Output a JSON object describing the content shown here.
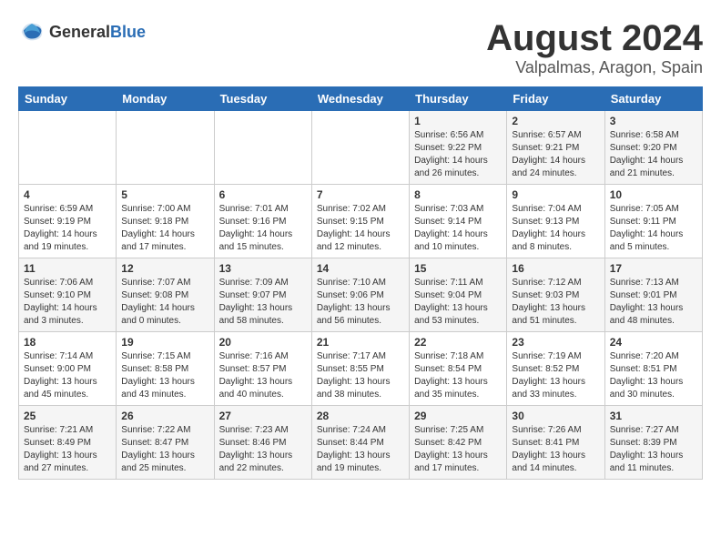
{
  "header": {
    "logo_general": "General",
    "logo_blue": "Blue",
    "month_title": "August 2024",
    "location": "Valpalmas, Aragon, Spain"
  },
  "weekdays": [
    "Sunday",
    "Monday",
    "Tuesday",
    "Wednesday",
    "Thursday",
    "Friday",
    "Saturday"
  ],
  "weeks": [
    [
      {
        "day": "",
        "content": ""
      },
      {
        "day": "",
        "content": ""
      },
      {
        "day": "",
        "content": ""
      },
      {
        "day": "",
        "content": ""
      },
      {
        "day": "1",
        "content": "Sunrise: 6:56 AM\nSunset: 9:22 PM\nDaylight: 14 hours\nand 26 minutes."
      },
      {
        "day": "2",
        "content": "Sunrise: 6:57 AM\nSunset: 9:21 PM\nDaylight: 14 hours\nand 24 minutes."
      },
      {
        "day": "3",
        "content": "Sunrise: 6:58 AM\nSunset: 9:20 PM\nDaylight: 14 hours\nand 21 minutes."
      }
    ],
    [
      {
        "day": "4",
        "content": "Sunrise: 6:59 AM\nSunset: 9:19 PM\nDaylight: 14 hours\nand 19 minutes."
      },
      {
        "day": "5",
        "content": "Sunrise: 7:00 AM\nSunset: 9:18 PM\nDaylight: 14 hours\nand 17 minutes."
      },
      {
        "day": "6",
        "content": "Sunrise: 7:01 AM\nSunset: 9:16 PM\nDaylight: 14 hours\nand 15 minutes."
      },
      {
        "day": "7",
        "content": "Sunrise: 7:02 AM\nSunset: 9:15 PM\nDaylight: 14 hours\nand 12 minutes."
      },
      {
        "day": "8",
        "content": "Sunrise: 7:03 AM\nSunset: 9:14 PM\nDaylight: 14 hours\nand 10 minutes."
      },
      {
        "day": "9",
        "content": "Sunrise: 7:04 AM\nSunset: 9:13 PM\nDaylight: 14 hours\nand 8 minutes."
      },
      {
        "day": "10",
        "content": "Sunrise: 7:05 AM\nSunset: 9:11 PM\nDaylight: 14 hours\nand 5 minutes."
      }
    ],
    [
      {
        "day": "11",
        "content": "Sunrise: 7:06 AM\nSunset: 9:10 PM\nDaylight: 14 hours\nand 3 minutes."
      },
      {
        "day": "12",
        "content": "Sunrise: 7:07 AM\nSunset: 9:08 PM\nDaylight: 14 hours\nand 0 minutes."
      },
      {
        "day": "13",
        "content": "Sunrise: 7:09 AM\nSunset: 9:07 PM\nDaylight: 13 hours\nand 58 minutes."
      },
      {
        "day": "14",
        "content": "Sunrise: 7:10 AM\nSunset: 9:06 PM\nDaylight: 13 hours\nand 56 minutes."
      },
      {
        "day": "15",
        "content": "Sunrise: 7:11 AM\nSunset: 9:04 PM\nDaylight: 13 hours\nand 53 minutes."
      },
      {
        "day": "16",
        "content": "Sunrise: 7:12 AM\nSunset: 9:03 PM\nDaylight: 13 hours\nand 51 minutes."
      },
      {
        "day": "17",
        "content": "Sunrise: 7:13 AM\nSunset: 9:01 PM\nDaylight: 13 hours\nand 48 minutes."
      }
    ],
    [
      {
        "day": "18",
        "content": "Sunrise: 7:14 AM\nSunset: 9:00 PM\nDaylight: 13 hours\nand 45 minutes."
      },
      {
        "day": "19",
        "content": "Sunrise: 7:15 AM\nSunset: 8:58 PM\nDaylight: 13 hours\nand 43 minutes."
      },
      {
        "day": "20",
        "content": "Sunrise: 7:16 AM\nSunset: 8:57 PM\nDaylight: 13 hours\nand 40 minutes."
      },
      {
        "day": "21",
        "content": "Sunrise: 7:17 AM\nSunset: 8:55 PM\nDaylight: 13 hours\nand 38 minutes."
      },
      {
        "day": "22",
        "content": "Sunrise: 7:18 AM\nSunset: 8:54 PM\nDaylight: 13 hours\nand 35 minutes."
      },
      {
        "day": "23",
        "content": "Sunrise: 7:19 AM\nSunset: 8:52 PM\nDaylight: 13 hours\nand 33 minutes."
      },
      {
        "day": "24",
        "content": "Sunrise: 7:20 AM\nSunset: 8:51 PM\nDaylight: 13 hours\nand 30 minutes."
      }
    ],
    [
      {
        "day": "25",
        "content": "Sunrise: 7:21 AM\nSunset: 8:49 PM\nDaylight: 13 hours\nand 27 minutes."
      },
      {
        "day": "26",
        "content": "Sunrise: 7:22 AM\nSunset: 8:47 PM\nDaylight: 13 hours\nand 25 minutes."
      },
      {
        "day": "27",
        "content": "Sunrise: 7:23 AM\nSunset: 8:46 PM\nDaylight: 13 hours\nand 22 minutes."
      },
      {
        "day": "28",
        "content": "Sunrise: 7:24 AM\nSunset: 8:44 PM\nDaylight: 13 hours\nand 19 minutes."
      },
      {
        "day": "29",
        "content": "Sunrise: 7:25 AM\nSunset: 8:42 PM\nDaylight: 13 hours\nand 17 minutes."
      },
      {
        "day": "30",
        "content": "Sunrise: 7:26 AM\nSunset: 8:41 PM\nDaylight: 13 hours\nand 14 minutes."
      },
      {
        "day": "31",
        "content": "Sunrise: 7:27 AM\nSunset: 8:39 PM\nDaylight: 13 hours\nand 11 minutes."
      }
    ]
  ]
}
